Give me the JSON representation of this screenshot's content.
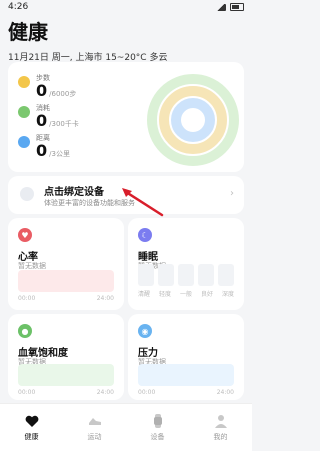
{
  "status_bar": {
    "time": "4:26"
  },
  "header": {
    "title": "健康",
    "subtitle": "11月21日 周一, 上海市 15~20°C 多云"
  },
  "summary": {
    "metrics": [
      {
        "label": "步数",
        "value": "0",
        "unit": "/6000步",
        "color": "#f3c64a"
      },
      {
        "label": "消耗",
        "value": "0",
        "unit": "/300千卡",
        "color": "#7bc86f"
      },
      {
        "label": "距离",
        "value": "0",
        "unit": "/3公里",
        "color": "#5aa8f1"
      }
    ],
    "ring_colors": [
      "#dbf1d6",
      "#f6e5b7",
      "#cde3fb"
    ]
  },
  "bind_device": {
    "title": "点击绑定设备",
    "subtitle": "体验更丰富的设备功能和服务"
  },
  "tiles": {
    "heart": {
      "title": "心率",
      "subtitle": "暂无数据",
      "axis_start": "00:00",
      "axis_end": "24:00",
      "icon_color": "#e95c64",
      "area_color": "#fde9ea"
    },
    "sleep": {
      "title": "睡眠",
      "subtitle": "暂无数据",
      "labels": [
        "清醒",
        "轻度",
        "一般",
        "良好",
        "深度"
      ],
      "icon_color": "#7b7cf0"
    },
    "spo2": {
      "title": "血氧饱和度",
      "subtitle": "暂无数据",
      "axis_start": "00:00",
      "axis_end": "24:00",
      "icon_color": "#6cc168",
      "area_color": "#e9f7e9"
    },
    "stress": {
      "title": "压力",
      "subtitle": "暂无数据",
      "axis_start": "00:00",
      "axis_end": "24:00",
      "icon_color": "#69b3f0",
      "area_color": "#e9f4fe"
    }
  },
  "bottom_nav": {
    "items": [
      {
        "label": "健康",
        "icon": "heart-icon",
        "active": true
      },
      {
        "label": "运动",
        "icon": "shoe-icon",
        "active": false
      },
      {
        "label": "设备",
        "icon": "watch-icon",
        "active": false
      },
      {
        "label": "我的",
        "icon": "person-icon",
        "active": false
      }
    ]
  }
}
